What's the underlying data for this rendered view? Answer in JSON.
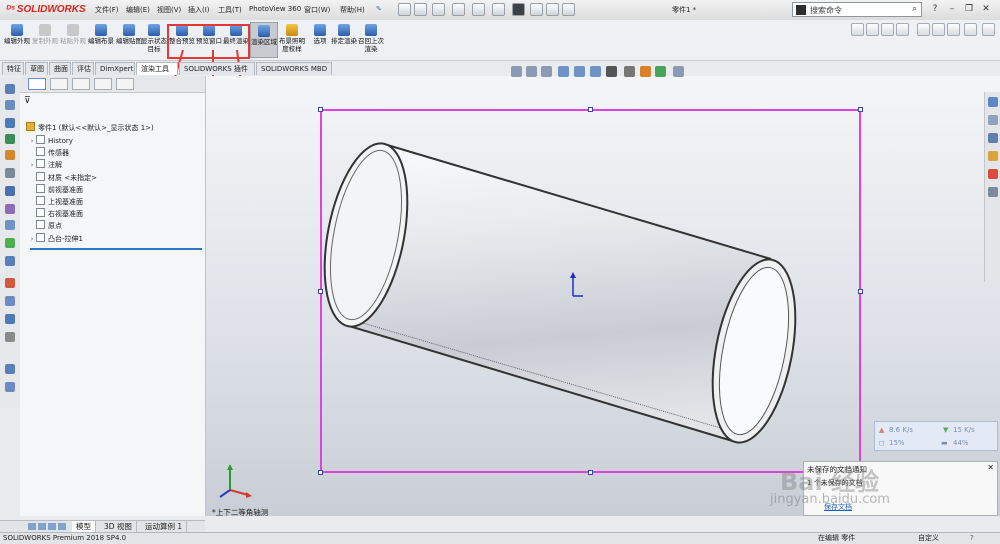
{
  "app": {
    "brand": "SOLIDWORKS",
    "brand_color": "#d9261c"
  },
  "menu": [
    "文件(F)",
    "编辑(E)",
    "视图(V)",
    "插入(I)",
    "工具(T)",
    "PhotoView 360",
    "窗口(W)",
    "帮助(H)"
  ],
  "document_title": "零件1 *",
  "search": {
    "placeholder": "搜索命令"
  },
  "commands": [
    {
      "label": "编辑外观",
      "state": "normal"
    },
    {
      "label": "复制外观",
      "state": "disabled"
    },
    {
      "label": "粘贴外观",
      "state": "disabled"
    },
    {
      "label": "编辑布景",
      "state": "normal"
    },
    {
      "label": "编辑贴图",
      "state": "normal"
    },
    {
      "label": "显示状态目标",
      "state": "normal"
    },
    {
      "label": "整合预览",
      "state": "normal"
    },
    {
      "label": "预览窗口",
      "state": "normal"
    },
    {
      "label": "最终渲染",
      "state": "normal"
    },
    {
      "label": "渲染区域",
      "state": "active"
    },
    {
      "label": "布景照明度校样",
      "state": "normal"
    },
    {
      "label": "选项",
      "state": "normal"
    },
    {
      "label": "排定渲染",
      "state": "normal"
    },
    {
      "label": "召回上次渲染",
      "state": "normal"
    }
  ],
  "tabs": [
    {
      "label": "特征",
      "active": false
    },
    {
      "label": "草图",
      "active": false
    },
    {
      "label": "曲面",
      "active": false
    },
    {
      "label": "评估",
      "active": false
    },
    {
      "label": "DimXpert",
      "active": false
    },
    {
      "label": "渲染工具",
      "active": true
    },
    {
      "label": "SOLIDWORKS 插件",
      "active": false
    },
    {
      "label": "SOLIDWORKS MBD",
      "active": false
    }
  ],
  "tree": {
    "root": "零件1 (默认<<默认>_显示状态 1>)",
    "items": [
      {
        "label": "History",
        "expandable": true
      },
      {
        "label": "传感器",
        "expandable": false
      },
      {
        "label": "注解",
        "expandable": true
      },
      {
        "label": "材质 <未指定>",
        "expandable": false
      },
      {
        "label": "前视基准面",
        "expandable": false
      },
      {
        "label": "上视基准面",
        "expandable": false
      },
      {
        "label": "右视基准面",
        "expandable": false
      },
      {
        "label": "原点",
        "expandable": false
      },
      {
        "label": "凸台-拉伸1",
        "expandable": true
      }
    ]
  },
  "graphics": {
    "view_name": "*上下二等角轴测",
    "selection_color": "#e040e0"
  },
  "network": {
    "up": "8.6 K/s",
    "down": "15 K/s",
    "cpu": "15%",
    "mem": "44%"
  },
  "notification": {
    "title": "未保存的文档通知",
    "body": "1 个未保存的文档",
    "link": "保存文档"
  },
  "bottom_tabs": [
    "模型",
    "3D 视图",
    "运动算例 1"
  ],
  "status": {
    "left": "SOLIDWORKS Premium 2018 SP4.0",
    "mode": "在编辑 零件",
    "custom": "自定义"
  },
  "watermark": {
    "text": "Bai 经验",
    "url": "jingyan.baidu.com"
  }
}
